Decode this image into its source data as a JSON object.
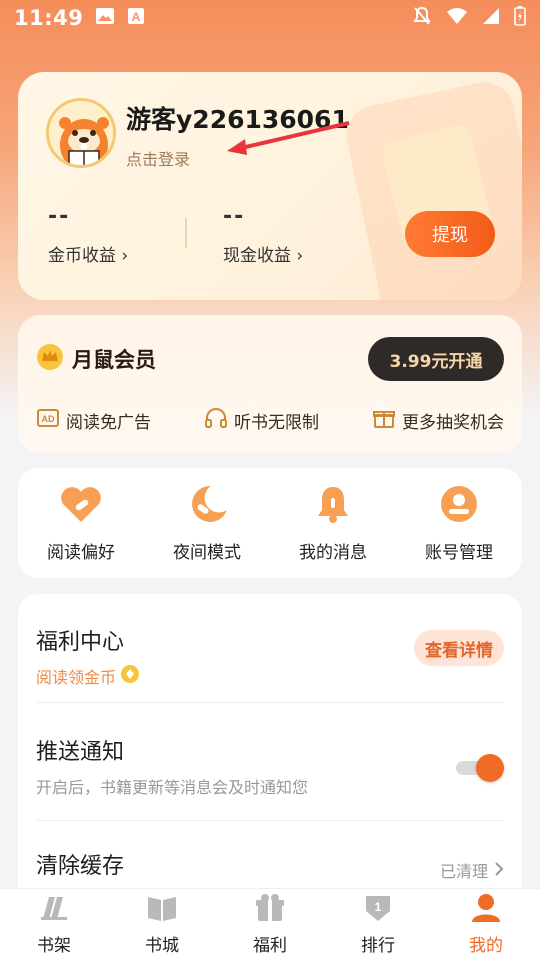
{
  "status_bar": {
    "time": "11:49"
  },
  "profile": {
    "username": "游客y226136061",
    "login_link": "点击登录",
    "coin_value": "--",
    "coin_label": "金币收益",
    "cash_value": "--",
    "cash_label": "现金收益",
    "withdraw_label": "提现"
  },
  "member": {
    "title": "月鼠会员",
    "button_label": "3.99元开通",
    "perks": [
      "阅读免广告",
      "听书无限制",
      "更多抽奖机会"
    ]
  },
  "quick_actions": [
    "阅读偏好",
    "夜间模式",
    "我的消息",
    "账号管理"
  ],
  "settings": {
    "welfare_title": "福利中心",
    "welfare_sub": "阅读领金币",
    "welfare_button": "查看详情",
    "push_title": "推送通知",
    "push_sub": "开启后，书籍更新等消息会及时通知您",
    "cache_title": "清除缓存",
    "cache_status": "已清理"
  },
  "bottom_nav": [
    {
      "label": "书架",
      "active": false
    },
    {
      "label": "书城",
      "active": false
    },
    {
      "label": "福利",
      "active": false
    },
    {
      "label": "排行",
      "active": false
    },
    {
      "label": "我的",
      "active": true
    }
  ],
  "colors": {
    "accent": "#f06b24",
    "member_btn_bg": "#2e2a28"
  }
}
